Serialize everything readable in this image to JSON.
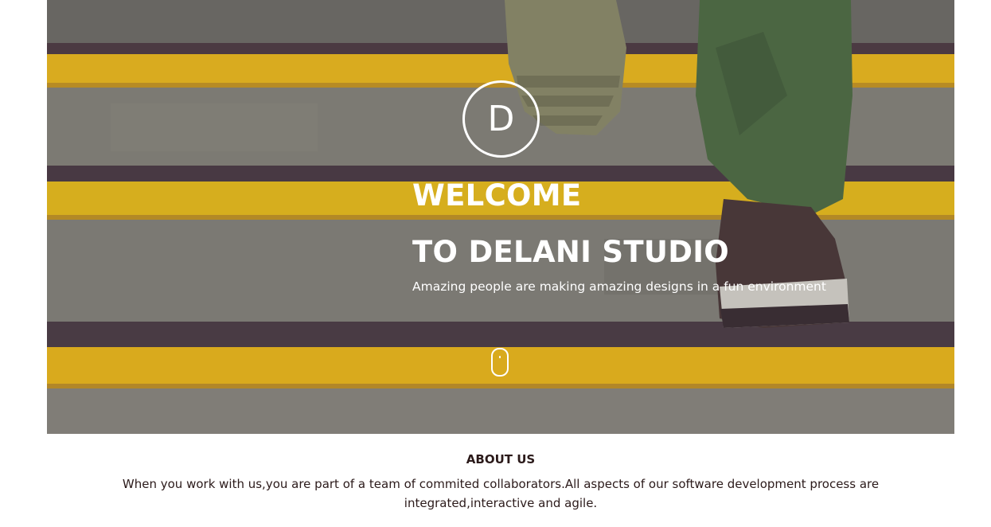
{
  "hero": {
    "logo_letter": "D",
    "title_line1": "WELCOME",
    "title_line2": "TO DELANI STUDIO",
    "subtitle": "Amazing people are making amazing designs in a fun environment",
    "scroll_icon": "mouse-scroll-icon"
  },
  "about": {
    "title": "ABOUT US",
    "text": "When you work with us,you are part of a team of commited collaborators.All aspects of our software development process are integrated,interactive and agile."
  },
  "colors": {
    "stripe_yellow": "#f2c21a",
    "step_gray": "#7d7e74",
    "text_dark": "#2b1a1a",
    "white": "#ffffff"
  }
}
